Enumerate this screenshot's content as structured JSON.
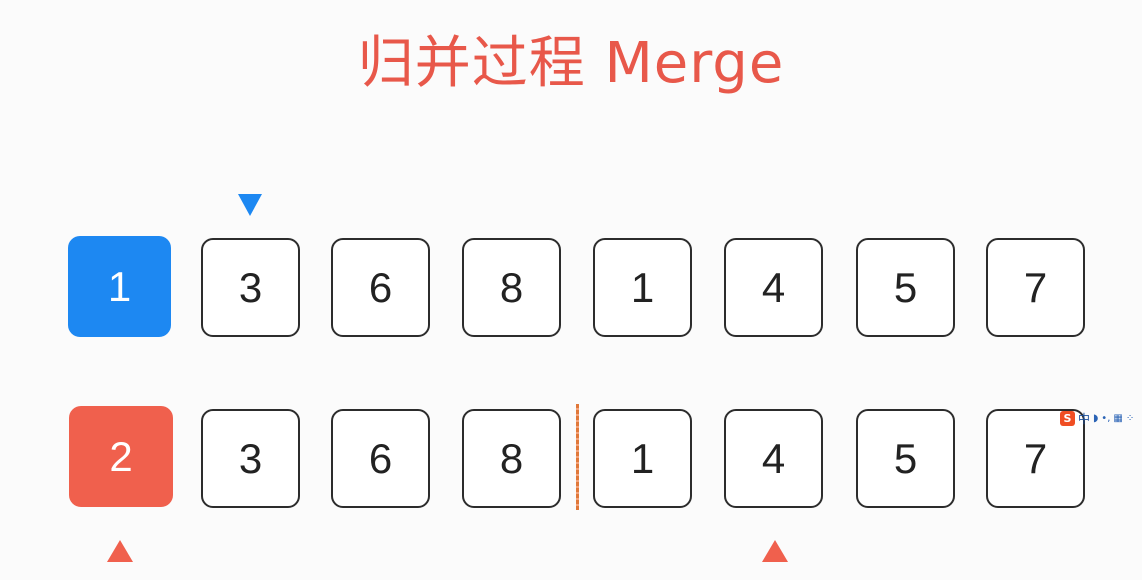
{
  "title": "归并过程 Merge",
  "top_row": [
    "1",
    "3",
    "6",
    "8",
    "1",
    "4",
    "5",
    "7"
  ],
  "bottom_row": [
    "2",
    "3",
    "6",
    "8",
    "1",
    "4",
    "5",
    "7"
  ],
  "colors": {
    "title": "#e8584a",
    "top_highlight": "#1d88f2",
    "bottom_highlight": "#f0604d",
    "divider": "#e0783a"
  },
  "ime_toolbar": {
    "logo": "S",
    "mode": "中"
  }
}
